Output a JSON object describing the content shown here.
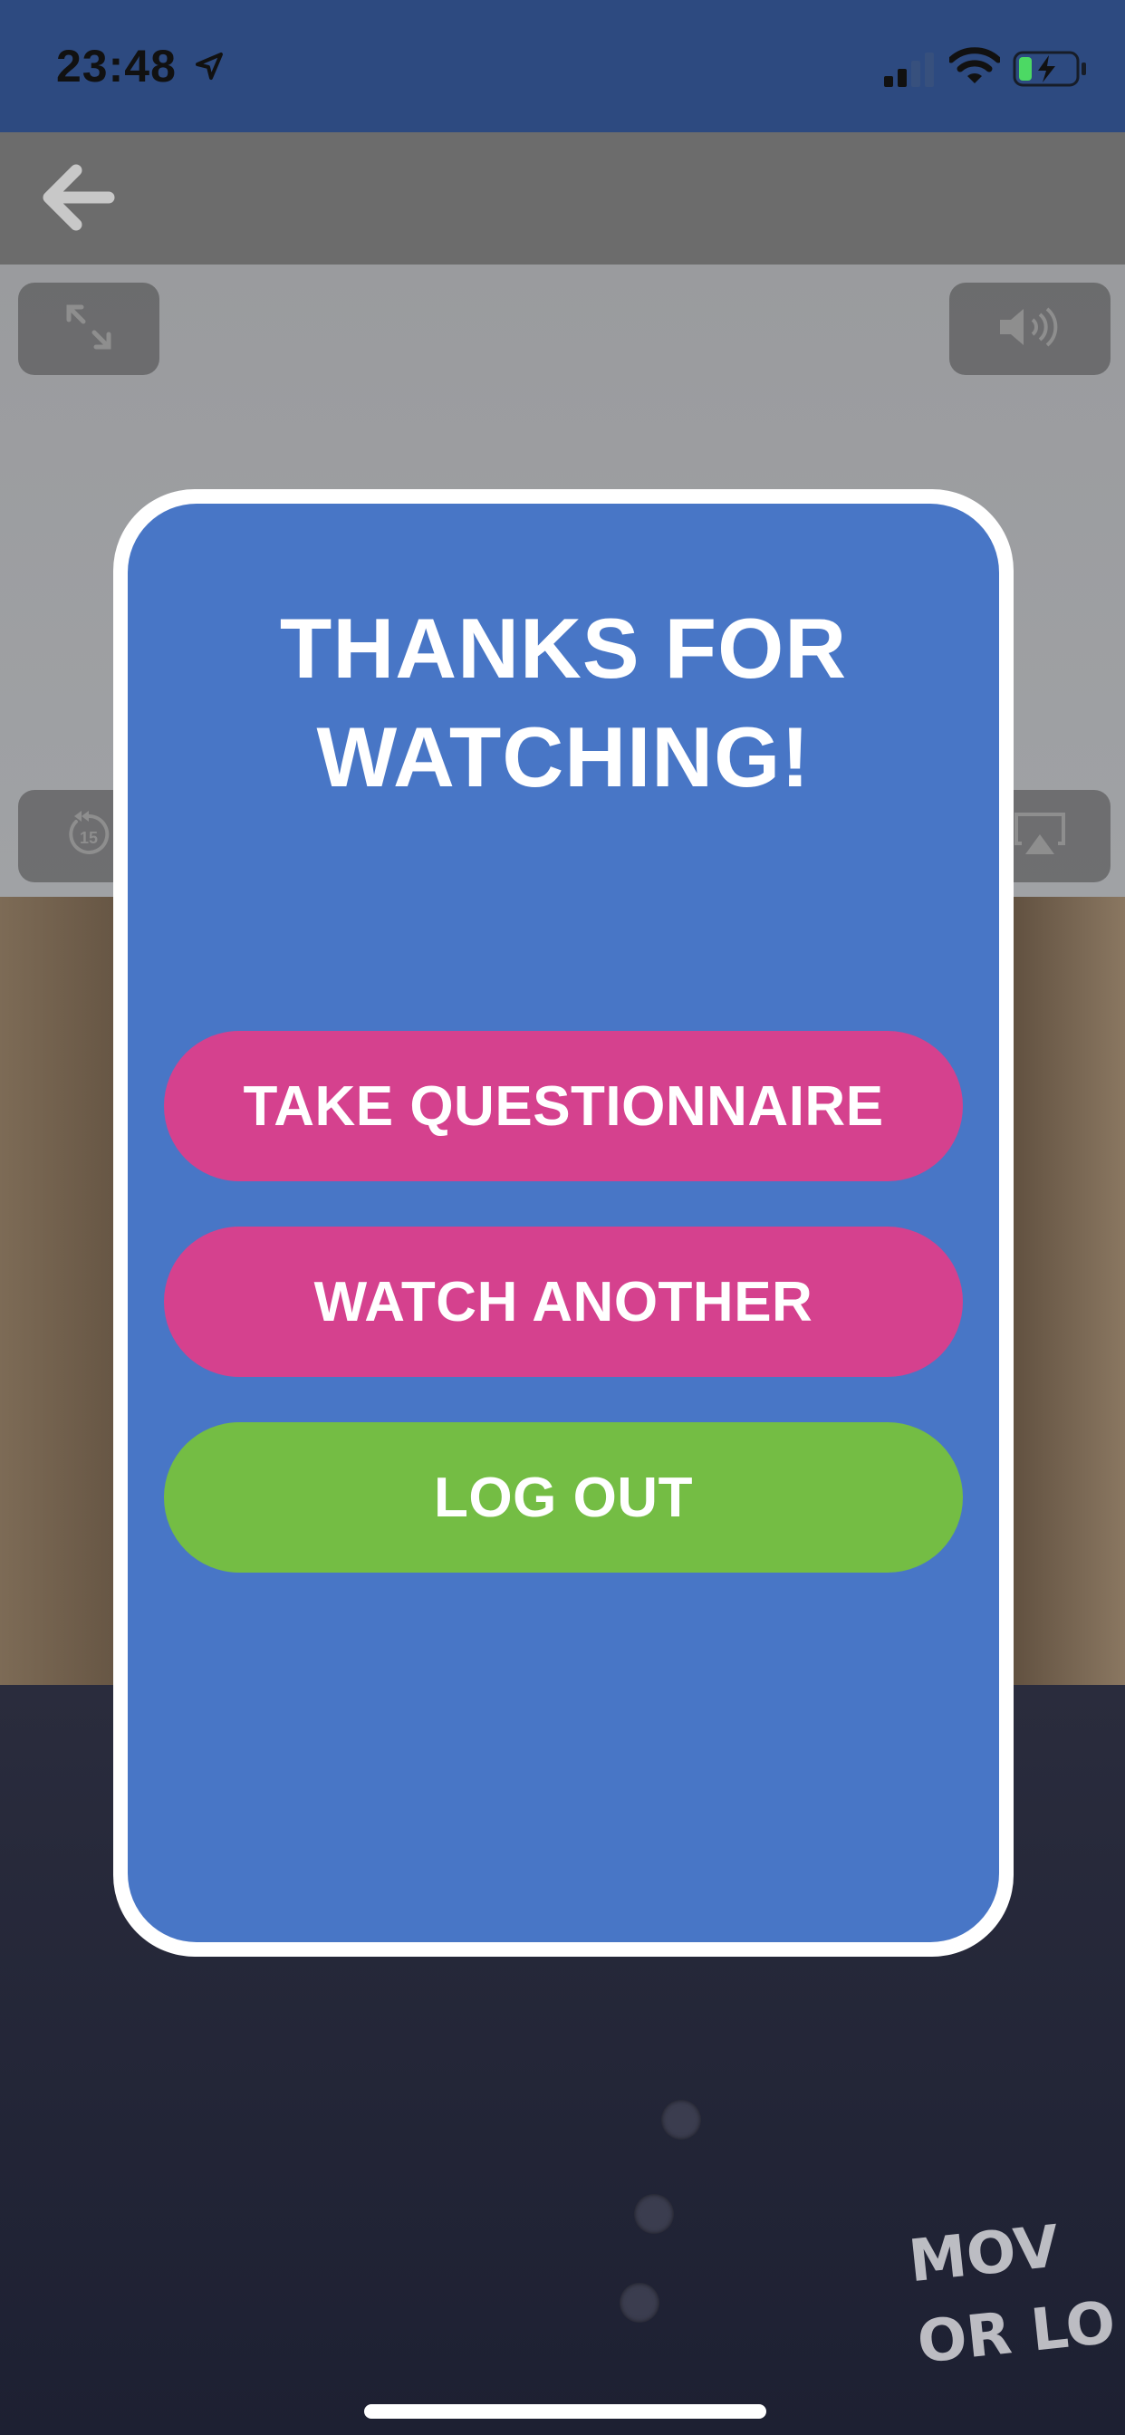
{
  "status_bar": {
    "time": "23:48",
    "icons": [
      "location-arrow-icon",
      "cellular-signal-icon",
      "wifi-icon",
      "battery-charging-icon"
    ]
  },
  "nav": {
    "back_icon": "arrow-left-icon"
  },
  "video_controls": {
    "icons": [
      "fullscreen-expand-icon",
      "volume-icon",
      "rewind-15-icon",
      "airplay-icon"
    ],
    "rewind_seconds": "15"
  },
  "modal": {
    "title_line1": "THANKS FOR",
    "title_line2": "WATCHING!",
    "buttons": {
      "questionnaire": "TAKE QUESTIONNAIRE",
      "watch_another": "WATCH ANOTHER",
      "log_out": "LOG OUT"
    }
  },
  "background": {
    "logo_line1": "MOV",
    "logo_line2": "OR LO"
  },
  "colors": {
    "status_bar": "#2d4a80",
    "modal_bg": "#4876c6",
    "modal_border": "#ffffff",
    "pink_button": "#d5418e",
    "green_button": "#74bd44"
  }
}
